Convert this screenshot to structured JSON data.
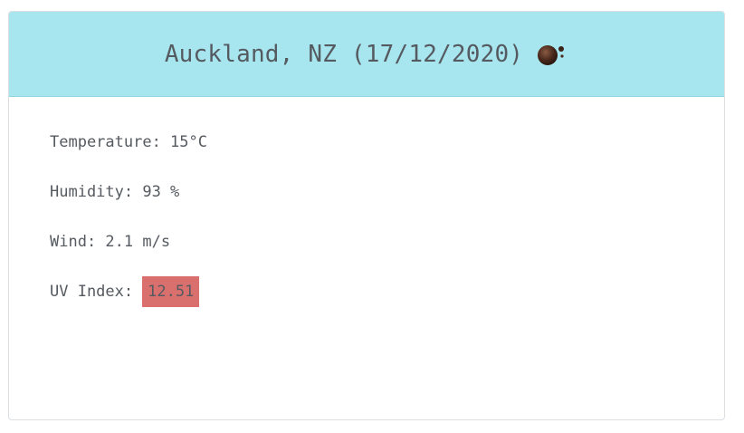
{
  "card": {
    "title": "Auckland, NZ (17/12/2020)",
    "icon": "weather-condition-icon"
  },
  "details": {
    "temperature": "Temperature: 15°C",
    "humidity": "Humidity: 93 %",
    "wind": "Wind: 2.1 m/s",
    "uv_label": "UV Index:",
    "uv_value": "12.51"
  },
  "colors": {
    "header_bg": "#a8e6ef",
    "uv_badge_bg": "#d9706e",
    "text": "#555a60"
  }
}
